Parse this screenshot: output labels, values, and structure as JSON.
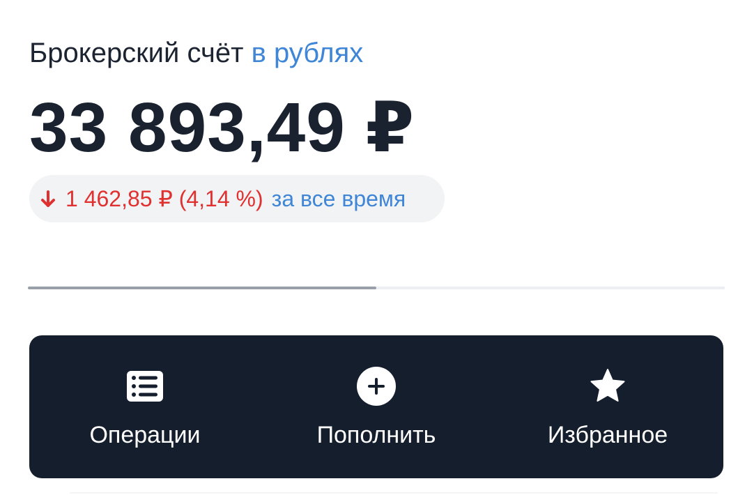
{
  "account": {
    "title": "Брокерский счёт",
    "currency_link": "в рублях",
    "balance": "33 893,49 ₽"
  },
  "change": {
    "direction": "down",
    "icon": "arrow-down-icon",
    "value": "1 462,85 ₽ (4,14 %)",
    "period": "за все время",
    "color": "#e03131",
    "period_color": "#3f86d6"
  },
  "carousel": {
    "progress_fraction": 0.5
  },
  "actions": [
    {
      "label": "Операции",
      "icon": "list-icon"
    },
    {
      "label": "Пополнить",
      "icon": "plus-circle-icon"
    },
    {
      "label": "Избранное",
      "icon": "star-icon"
    }
  ],
  "colors": {
    "accent_blue": "#3f86d6",
    "negative_red": "#e03131",
    "panel_dark": "#151e2d",
    "text_dark": "#1c2331"
  }
}
